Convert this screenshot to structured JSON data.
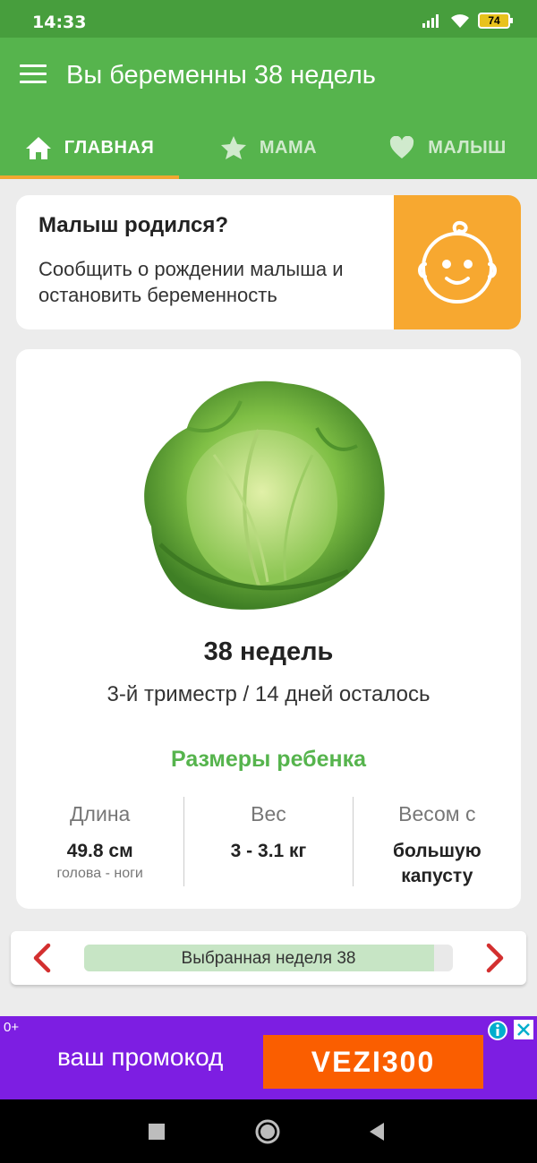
{
  "status": {
    "time": "14:33",
    "battery": "74",
    "icons": [
      "signal-icon",
      "wifi-icon",
      "battery-icon"
    ]
  },
  "appbar": {
    "title": "Вы беременны 38 недель",
    "menu_icon": "hamburger-menu-icon"
  },
  "tabs": [
    {
      "label": "ГЛАВНАЯ",
      "icon": "home-icon",
      "active": true
    },
    {
      "label": "МАМА",
      "icon": "star-icon",
      "active": false
    },
    {
      "label": "МАЛЫШ",
      "icon": "heart-icon",
      "active": false
    }
  ],
  "birth_card": {
    "title": "Малыш родился?",
    "text": "Сообщить о рождении малыша и остановить беременность",
    "icon": "baby-face-icon"
  },
  "week_card": {
    "weeks": "38 недель",
    "trimester": "3-й триместр / 14 дней осталось",
    "sizes_title": "Размеры ребенка",
    "metrics": [
      {
        "label": "Длина",
        "value": "49.8 см",
        "sub": "голова - ноги"
      },
      {
        "label": "Вес",
        "value": "3 - 3.1 кг",
        "sub": ""
      },
      {
        "label": "Весом с",
        "value": "большую капусту",
        "sub": ""
      }
    ]
  },
  "week_nav": {
    "label": "Выбранная неделя 38",
    "progress_percent": 95
  },
  "ad": {
    "age": "0+",
    "promo": "ваш промокод",
    "code": "VEZI300"
  },
  "colors": {
    "green": "#56b44d",
    "dark_green": "#479e3d",
    "orange": "#f7a830",
    "ad_purple": "#7d1ee2",
    "ad_orange": "#fa5e00",
    "arrow_red": "#d32f2f"
  }
}
